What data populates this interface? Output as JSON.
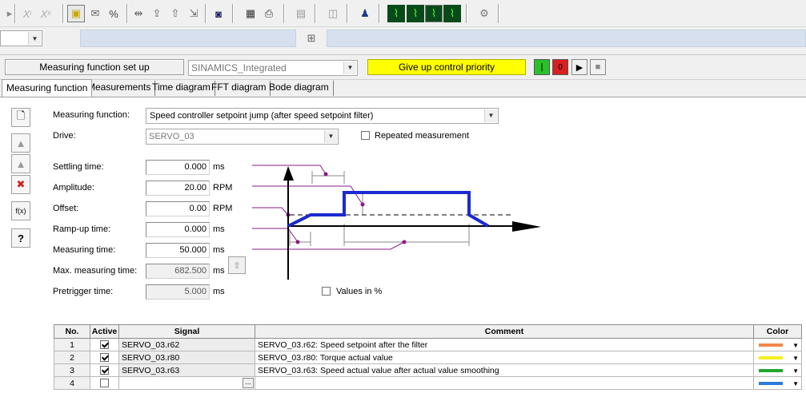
{
  "toolbar": {
    "icons": [
      "x1-icon",
      "x2-icon",
      "toggle-icon",
      "envelope-icon",
      "percent-icon",
      "zoom-in-icon",
      "upload-icon",
      "upload-2-icon",
      "export-icon",
      "fit-icon",
      "grid-icon",
      "save-icon",
      "document-icon",
      "camera-icon",
      "people-icon",
      "trace-1-icon",
      "trace-2-icon",
      "trace-3-icon",
      "trace-4-icon",
      "settings-icon"
    ]
  },
  "header": {
    "status_label": "Measuring function set up",
    "device": "SINAMICS_Integrated",
    "control_button": "Give up control priority",
    "control_color": "#ffff00"
  },
  "tabs": [
    {
      "label": "Measuring function",
      "active": true
    },
    {
      "label": "Measurements",
      "active": false
    },
    {
      "label": "Time diagram",
      "active": false
    },
    {
      "label": "FFT diagram",
      "active": false
    },
    {
      "label": "Bode diagram",
      "active": false
    }
  ],
  "form": {
    "measuring_function_label": "Measuring function:",
    "measuring_function_value": "Speed controller setpoint jump (after speed setpoint filter)",
    "drive_label": "Drive:",
    "drive_value": "SERVO_03",
    "repeated_label": "Repeated measurement",
    "settling_label": "Settling time:",
    "settling_value": "0.000",
    "settling_unit": "ms",
    "amplitude_label": "Amplitude:",
    "amplitude_value": "20.00",
    "amplitude_unit": "RPM",
    "offset_label": "Offset:",
    "offset_value": "0.00",
    "offset_unit": "RPM",
    "rampup_label": "Ramp-up time:",
    "rampup_value": "0.000",
    "rampup_unit": "ms",
    "measuring_time_label": "Measuring time:",
    "measuring_time_value": "50.000",
    "measuring_time_unit": "ms",
    "max_time_label": "Max. measuring time:",
    "max_time_value": "682.500",
    "max_time_unit": "ms",
    "pretrigger_label": "Pretrigger time:",
    "pretrigger_value": "5.000",
    "pretrigger_unit": "ms",
    "values_percent_label": "Values in %"
  },
  "table": {
    "headers": [
      "No.",
      "Active",
      "Signal",
      "Comment",
      "Color"
    ],
    "rows": [
      {
        "no": "1",
        "active": true,
        "signal": "SERVO_03.r62",
        "comment": "SERVO_03.r62: Speed setpoint after the filter",
        "color": "#f0884a"
      },
      {
        "no": "2",
        "active": true,
        "signal": "SERVO_03.r80",
        "comment": "SERVO_03.r80: Torque actual value",
        "color": "#f4f01c"
      },
      {
        "no": "3",
        "active": true,
        "signal": "SERVO_03.r63",
        "comment": "SERVO_03.r63: Speed actual value after actual value smoothing",
        "color": "#1ea82a"
      },
      {
        "no": "4",
        "active": false,
        "signal": "",
        "comment": "",
        "color": "#2a7ad8"
      }
    ],
    "browse_label": "..."
  },
  "side_buttons": [
    "new-document-icon",
    "open-icon",
    "save-icon",
    "delete-icon",
    "function-icon",
    "help-icon"
  ],
  "help_label": "?"
}
